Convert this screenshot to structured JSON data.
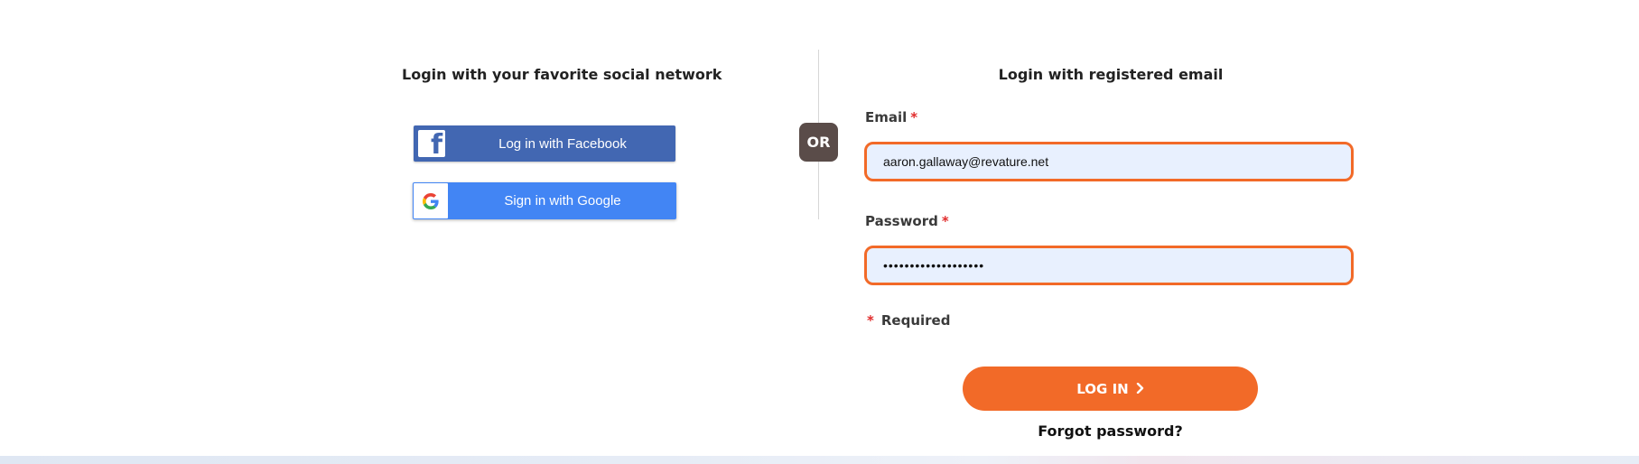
{
  "social": {
    "title": "Login with your favorite social network",
    "facebook_label": "Log in with Facebook",
    "facebook_icon": "facebook-icon",
    "google_label": "Sign in with Google",
    "google_icon": "google-icon"
  },
  "divider": {
    "or_label": "OR"
  },
  "email_login": {
    "title": "Login with registered email",
    "email_label": "Email",
    "email_value": "aaron.gallaway@revature.net",
    "password_label": "Password",
    "password_value": "•••••••••••••••••••",
    "required_star": "*",
    "required_note": "Required",
    "login_label": "LOG IN",
    "login_icon": "chevron-right-icon",
    "forgot_label": "Forgot password?"
  },
  "colors": {
    "accent": "#f26a28",
    "facebook": "#4267b2",
    "google": "#4285f4",
    "or_badge": "#5a4c49",
    "required": "#e12c2c"
  }
}
